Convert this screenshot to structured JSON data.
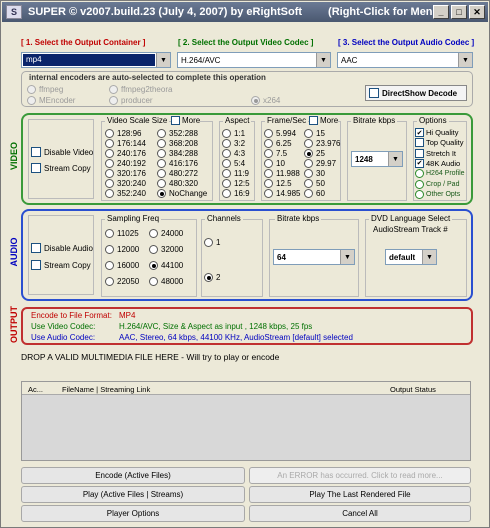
{
  "title_bar": {
    "title": "SUPER © v2007.build.23 (July 4, 2007) by eRightSoft",
    "menu_hint": "(Right-Click for Menu)"
  },
  "output_container": {
    "label": "[ 1.     Select the Output Container ]",
    "value": "mp4"
  },
  "video_codec": {
    "label": "[ 2.  Select the Output Video Codec ]",
    "value": "H.264/AVC"
  },
  "audio_codec": {
    "label": "[ 3.  Select the Output Audio Codec ]",
    "value": "AAC"
  },
  "encoders": {
    "note": "internal encoders are auto-selected to complete this operation",
    "options": [
      "ffmpeg",
      "ffmpeg2theora",
      "x264",
      "MEncoder",
      "producer"
    ],
    "directshow_label": "DirectShow Decode"
  },
  "video": {
    "section_label": "VIDEO",
    "disable_label": "Disable Video",
    "stream_copy_label": "Stream Copy",
    "scale_title": "Video Scale Size",
    "scale_more": "More",
    "scale_col1": [
      "128:96",
      "176:144",
      "240:176",
      "240:192",
      "320:176",
      "320:240",
      "352:240"
    ],
    "scale_col2": [
      "352:288",
      "368:208",
      "384:288",
      "416:176",
      "480:272",
      "480:320",
      "NoChange"
    ],
    "scale_selected": "NoChange",
    "aspect_title": "Aspect",
    "aspect": [
      "1:1",
      "3:2",
      "4:3",
      "5:4",
      "11:9",
      "12:5",
      "16:9"
    ],
    "fps_title": "Frame/Sec",
    "fps_more": "More",
    "fps_col1": [
      "5.994",
      "6.25",
      "7.5",
      "10",
      "11.988",
      "12.5",
      "14.985"
    ],
    "fps_col2": [
      "15",
      "23.976",
      "25",
      "29.97",
      "30",
      "50",
      "60"
    ],
    "fps_selected": "25",
    "bitrate_title": "Bitrate  kbps",
    "bitrate_value": "1248",
    "options_title": "Options",
    "options": [
      "Hi Quality",
      "Top Quality",
      "Stretch It",
      "48K Audio",
      "H264 Profile",
      "Crop / Pad",
      "Other Opts"
    ]
  },
  "audio": {
    "section_label": "AUDIO",
    "disable_label": "Disable Audio",
    "stream_copy_label": "Stream Copy",
    "freq_title": "Sampling Freq",
    "freq_col1": [
      "11025",
      "12000",
      "16000",
      "22050"
    ],
    "freq_col2": [
      "24000",
      "32000",
      "44100",
      "48000"
    ],
    "freq_selected": "44100",
    "channels_title": "Channels",
    "channels": [
      "1",
      "2"
    ],
    "channels_selected": "2",
    "bitrate_title": "Bitrate  kbps",
    "bitrate_value": "64",
    "dvd_title": "DVD Language Select",
    "dvd_subtitle": "AudioStream  Track #",
    "dvd_value": "default"
  },
  "output": {
    "section_label": "OUTPUT",
    "lines": [
      {
        "label": "Encode to File Format:",
        "value": "MP4"
      },
      {
        "label": "Use Video Codec:",
        "value": "H.264/AVC,  Size & Aspect as input ,  1248 kbps,  25 fps"
      },
      {
        "label": "Use Audio Codec:",
        "value": "AAC,  Stereo,  64 kbps,  44100 KHz,  AudioStream [default] selected"
      }
    ]
  },
  "drop_hint": "DROP A VALID MULTIMEDIA FILE HERE - Will try to play or encode",
  "file_table": {
    "headers": [
      "Ac...",
      "FileName  |  Streaming Link",
      "Output Status"
    ]
  },
  "buttons": {
    "encode": "Encode (Active Files)",
    "error": "An ERROR has occurred. Click to read more...",
    "play": "Play (Active Files | Streams)",
    "play_last": "Play The Last Rendered File",
    "player_options": "Player Options",
    "cancel_all": "Cancel All"
  }
}
